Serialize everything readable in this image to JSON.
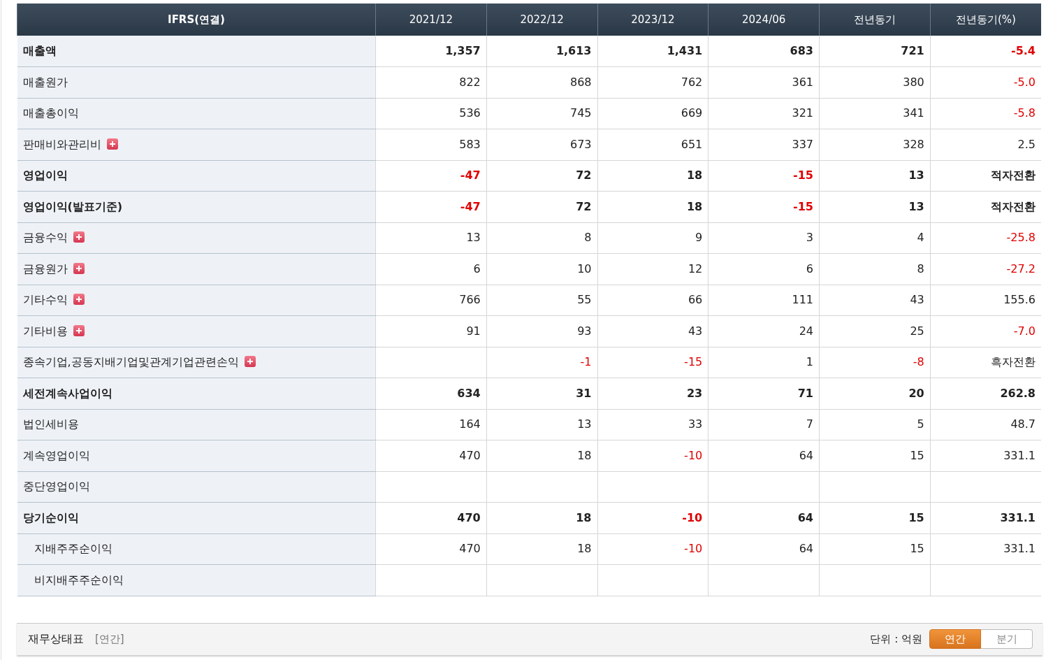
{
  "table": {
    "columns": [
      "IFRS(연결)",
      "2021/12",
      "2022/12",
      "2023/12",
      "2024/06",
      "전년동기",
      "전년동기(%)"
    ],
    "rows": [
      {
        "label": "매출액",
        "bold": true,
        "expandable": false,
        "values": {
          "col_1": "1,357",
          "col_2": "1,613",
          "col_3": "1,431",
          "col_4": "683",
          "col_5": "721",
          "col_6": "-5.4"
        }
      },
      {
        "label": "매출원가",
        "bold": false,
        "expandable": false,
        "values": {
          "col_1": "822",
          "col_2": "868",
          "col_3": "762",
          "col_4": "361",
          "col_5": "380",
          "col_6": "-5.0"
        }
      },
      {
        "label": "매출총이익",
        "bold": false,
        "expandable": false,
        "values": {
          "col_1": "536",
          "col_2": "745",
          "col_3": "669",
          "col_4": "321",
          "col_5": "341",
          "col_6": "-5.8"
        }
      },
      {
        "label": "판매비와관리비",
        "bold": false,
        "expandable": true,
        "values": {
          "col_1": "583",
          "col_2": "673",
          "col_3": "651",
          "col_4": "337",
          "col_5": "328",
          "col_6": "2.5"
        }
      },
      {
        "label": "영업이익",
        "bold": true,
        "expandable": false,
        "values": {
          "col_1": "-47",
          "col_2": "72",
          "col_3": "18",
          "col_4": "-15",
          "col_5": "13",
          "col_6": "적자전환"
        }
      },
      {
        "label": "영업이익(발표기준)",
        "bold": true,
        "expandable": false,
        "values": {
          "col_1": "-47",
          "col_2": "72",
          "col_3": "18",
          "col_4": "-15",
          "col_5": "13",
          "col_6": "적자전환"
        }
      },
      {
        "label": "금융수익",
        "bold": false,
        "expandable": true,
        "values": {
          "col_1": "13",
          "col_2": "8",
          "col_3": "9",
          "col_4": "3",
          "col_5": "4",
          "col_6": "-25.8"
        }
      },
      {
        "label": "금융원가",
        "bold": false,
        "expandable": true,
        "values": {
          "col_1": "6",
          "col_2": "10",
          "col_3": "12",
          "col_4": "6",
          "col_5": "8",
          "col_6": "-27.2"
        }
      },
      {
        "label": "기타수익",
        "bold": false,
        "expandable": true,
        "values": {
          "col_1": "766",
          "col_2": "55",
          "col_3": "66",
          "col_4": "111",
          "col_5": "43",
          "col_6": "155.6"
        }
      },
      {
        "label": "기타비용",
        "bold": false,
        "expandable": true,
        "values": {
          "col_1": "91",
          "col_2": "93",
          "col_3": "43",
          "col_4": "24",
          "col_5": "25",
          "col_6": "-7.0"
        }
      },
      {
        "label": "종속기업,공동지배기업및관계기업관련손익",
        "bold": false,
        "expandable": true,
        "values": {
          "col_2": "-1",
          "col_3": "-15",
          "col_4": "1",
          "col_5": "-8",
          "col_6": "흑자전환"
        }
      },
      {
        "label": "세전계속사업이익",
        "bold": true,
        "expandable": false,
        "values": {
          "col_1": "634",
          "col_2": "31",
          "col_3": "23",
          "col_4": "71",
          "col_5": "20",
          "col_6": "262.8"
        }
      },
      {
        "label": "법인세비용",
        "bold": false,
        "expandable": false,
        "values": {
          "col_1": "164",
          "col_2": "13",
          "col_3": "33",
          "col_4": "7",
          "col_5": "5",
          "col_6": "48.7"
        }
      },
      {
        "label": "계속영업이익",
        "bold": false,
        "expandable": false,
        "values": {
          "col_1": "470",
          "col_2": "18",
          "col_3": "-10",
          "col_4": "64",
          "col_5": "15",
          "col_6": "331.1"
        }
      },
      {
        "label": "중단영업이익",
        "bold": false,
        "expandable": false
      },
      {
        "label": "당기순이익",
        "bold": true,
        "expandable": false,
        "values": {
          "col_1": "470",
          "col_2": "18",
          "col_3": "-10",
          "col_4": "64",
          "col_5": "15",
          "col_6": "331.1"
        },
        "children": [
          {
            "label": "지배주주순이익",
            "bold": false,
            "expandable": false,
            "values": {
              "col_1": "470",
              "col_2": "18",
              "col_3": "-10",
              "col_4": "64",
              "col_5": "15",
              "col_6": "331.1"
            }
          },
          {
            "label": "비지배주주순이익",
            "bold": false,
            "expandable": false
          }
        ]
      }
    ]
  },
  "footer": {
    "title": "재무상태표",
    "period": "[연간]",
    "unit": "단위 : 억원",
    "toggles": [
      {
        "label": "연간",
        "selected": true
      },
      {
        "label": "분기",
        "selected": false
      }
    ]
  }
}
